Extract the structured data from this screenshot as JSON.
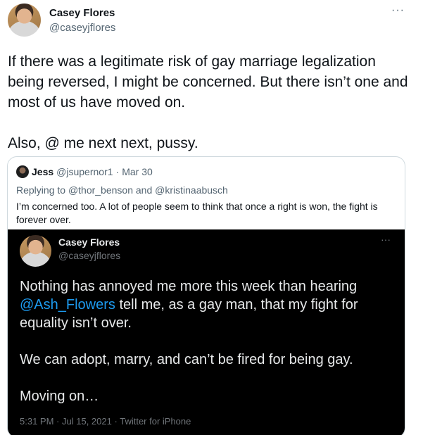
{
  "tweet": {
    "author_name": "Casey Flores",
    "author_handle": "@caseyjflores",
    "more_label": "···",
    "text_para1": "If there was a legitimate risk of gay marriage legalization being reversed, I might be concerned. But there isn’t one and most of us have moved on.",
    "text_para2": "Also, @ me next next, pussy."
  },
  "quoted": {
    "author_name": "Jess",
    "author_handle": "@jsupernor1",
    "separator": "·",
    "date": "Mar 30",
    "reply_prefix": "Replying to",
    "reply_to_1": "@thor_benson",
    "reply_and": "and",
    "reply_to_2": "@kristinaabusch",
    "text": "I’m concerned too. A lot of people seem to think that once a right is won, the fight is forever over."
  },
  "screenshot": {
    "author_name": "Casey Flores",
    "author_handle": "@caseyjflores",
    "more_label": "···",
    "line1_before": "Nothing has annoyed me more this week than hearing",
    "mention": "@Ash_Flowers",
    "line1_after": "tell me, as a gay man, that my fight for equality isn’t over.",
    "para2": "We can adopt, marry, and can’t be fired for being gay.",
    "para3": "Moving on…",
    "time": "5:31 PM",
    "separator": "·",
    "date": "Jul 15, 2021",
    "separator2": "·",
    "source": "Twitter for iPhone"
  }
}
